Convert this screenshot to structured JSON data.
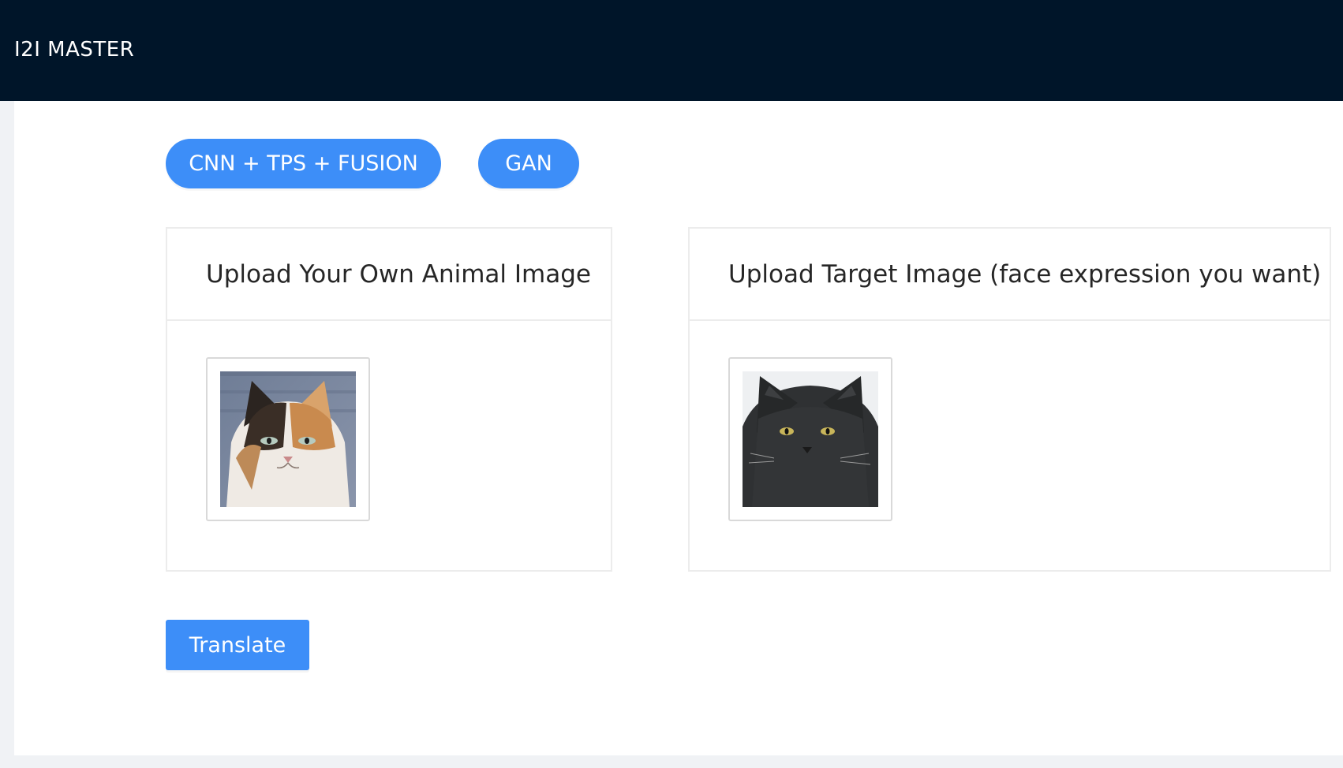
{
  "header": {
    "logo": "I2I MASTER"
  },
  "models": {
    "cnn_label": "CNN + TPS + FUSION",
    "gan_label": "GAN"
  },
  "cards": {
    "source": {
      "title": "Upload Your Own Animal Image",
      "image_icon": "calico-cat-photo"
    },
    "target": {
      "title": "Upload Target Image (face expression you want)",
      "image_icon": "black-cat-photo"
    }
  },
  "actions": {
    "translate_label": "Translate"
  },
  "colors": {
    "header_bg": "#001529",
    "primary": "#3d8ef8",
    "page_bg": "#f0f2f5"
  }
}
